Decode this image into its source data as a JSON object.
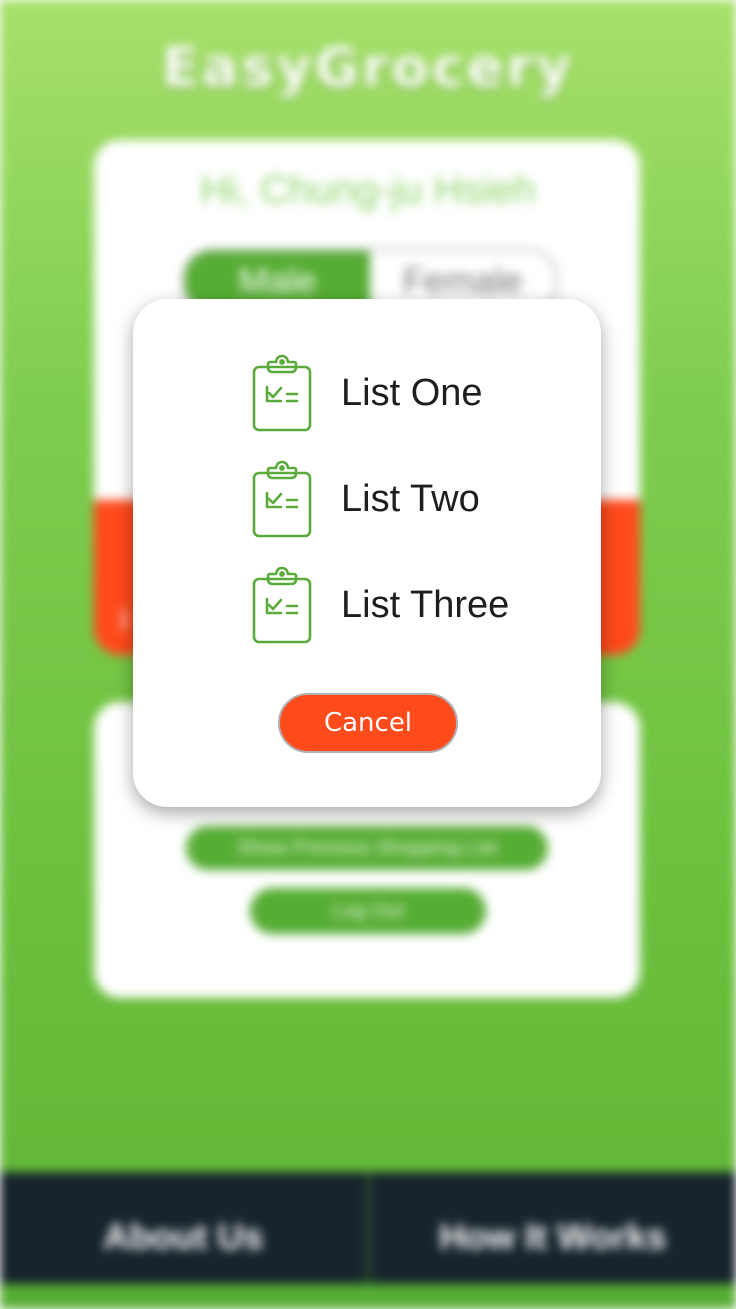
{
  "background_app": {
    "title": "EasyGrocery",
    "greeting": "Hi, Chung-ju Hsieh",
    "gender_toggle": {
      "male_label": "Male",
      "female_label": "Female"
    },
    "actions": {
      "show_previous_label": "Show Previous Shopping List",
      "log_out_label": "Log Out"
    },
    "bottom_nav": {
      "about_label": "About Us",
      "how_label": "How It Works"
    }
  },
  "modal": {
    "options": [
      {
        "label": "List One",
        "icon": "clipboard-checklist-icon"
      },
      {
        "label": "List Two",
        "icon": "clipboard-checklist-icon"
      },
      {
        "label": "List Three",
        "icon": "clipboard-checklist-icon"
      }
    ],
    "cancel_label": "Cancel"
  },
  "colors": {
    "brand_green": "#56ad34",
    "accent_orange": "#ff4a1c",
    "nav_dark": "#17242d",
    "icon_green": "#5aaa3c"
  }
}
